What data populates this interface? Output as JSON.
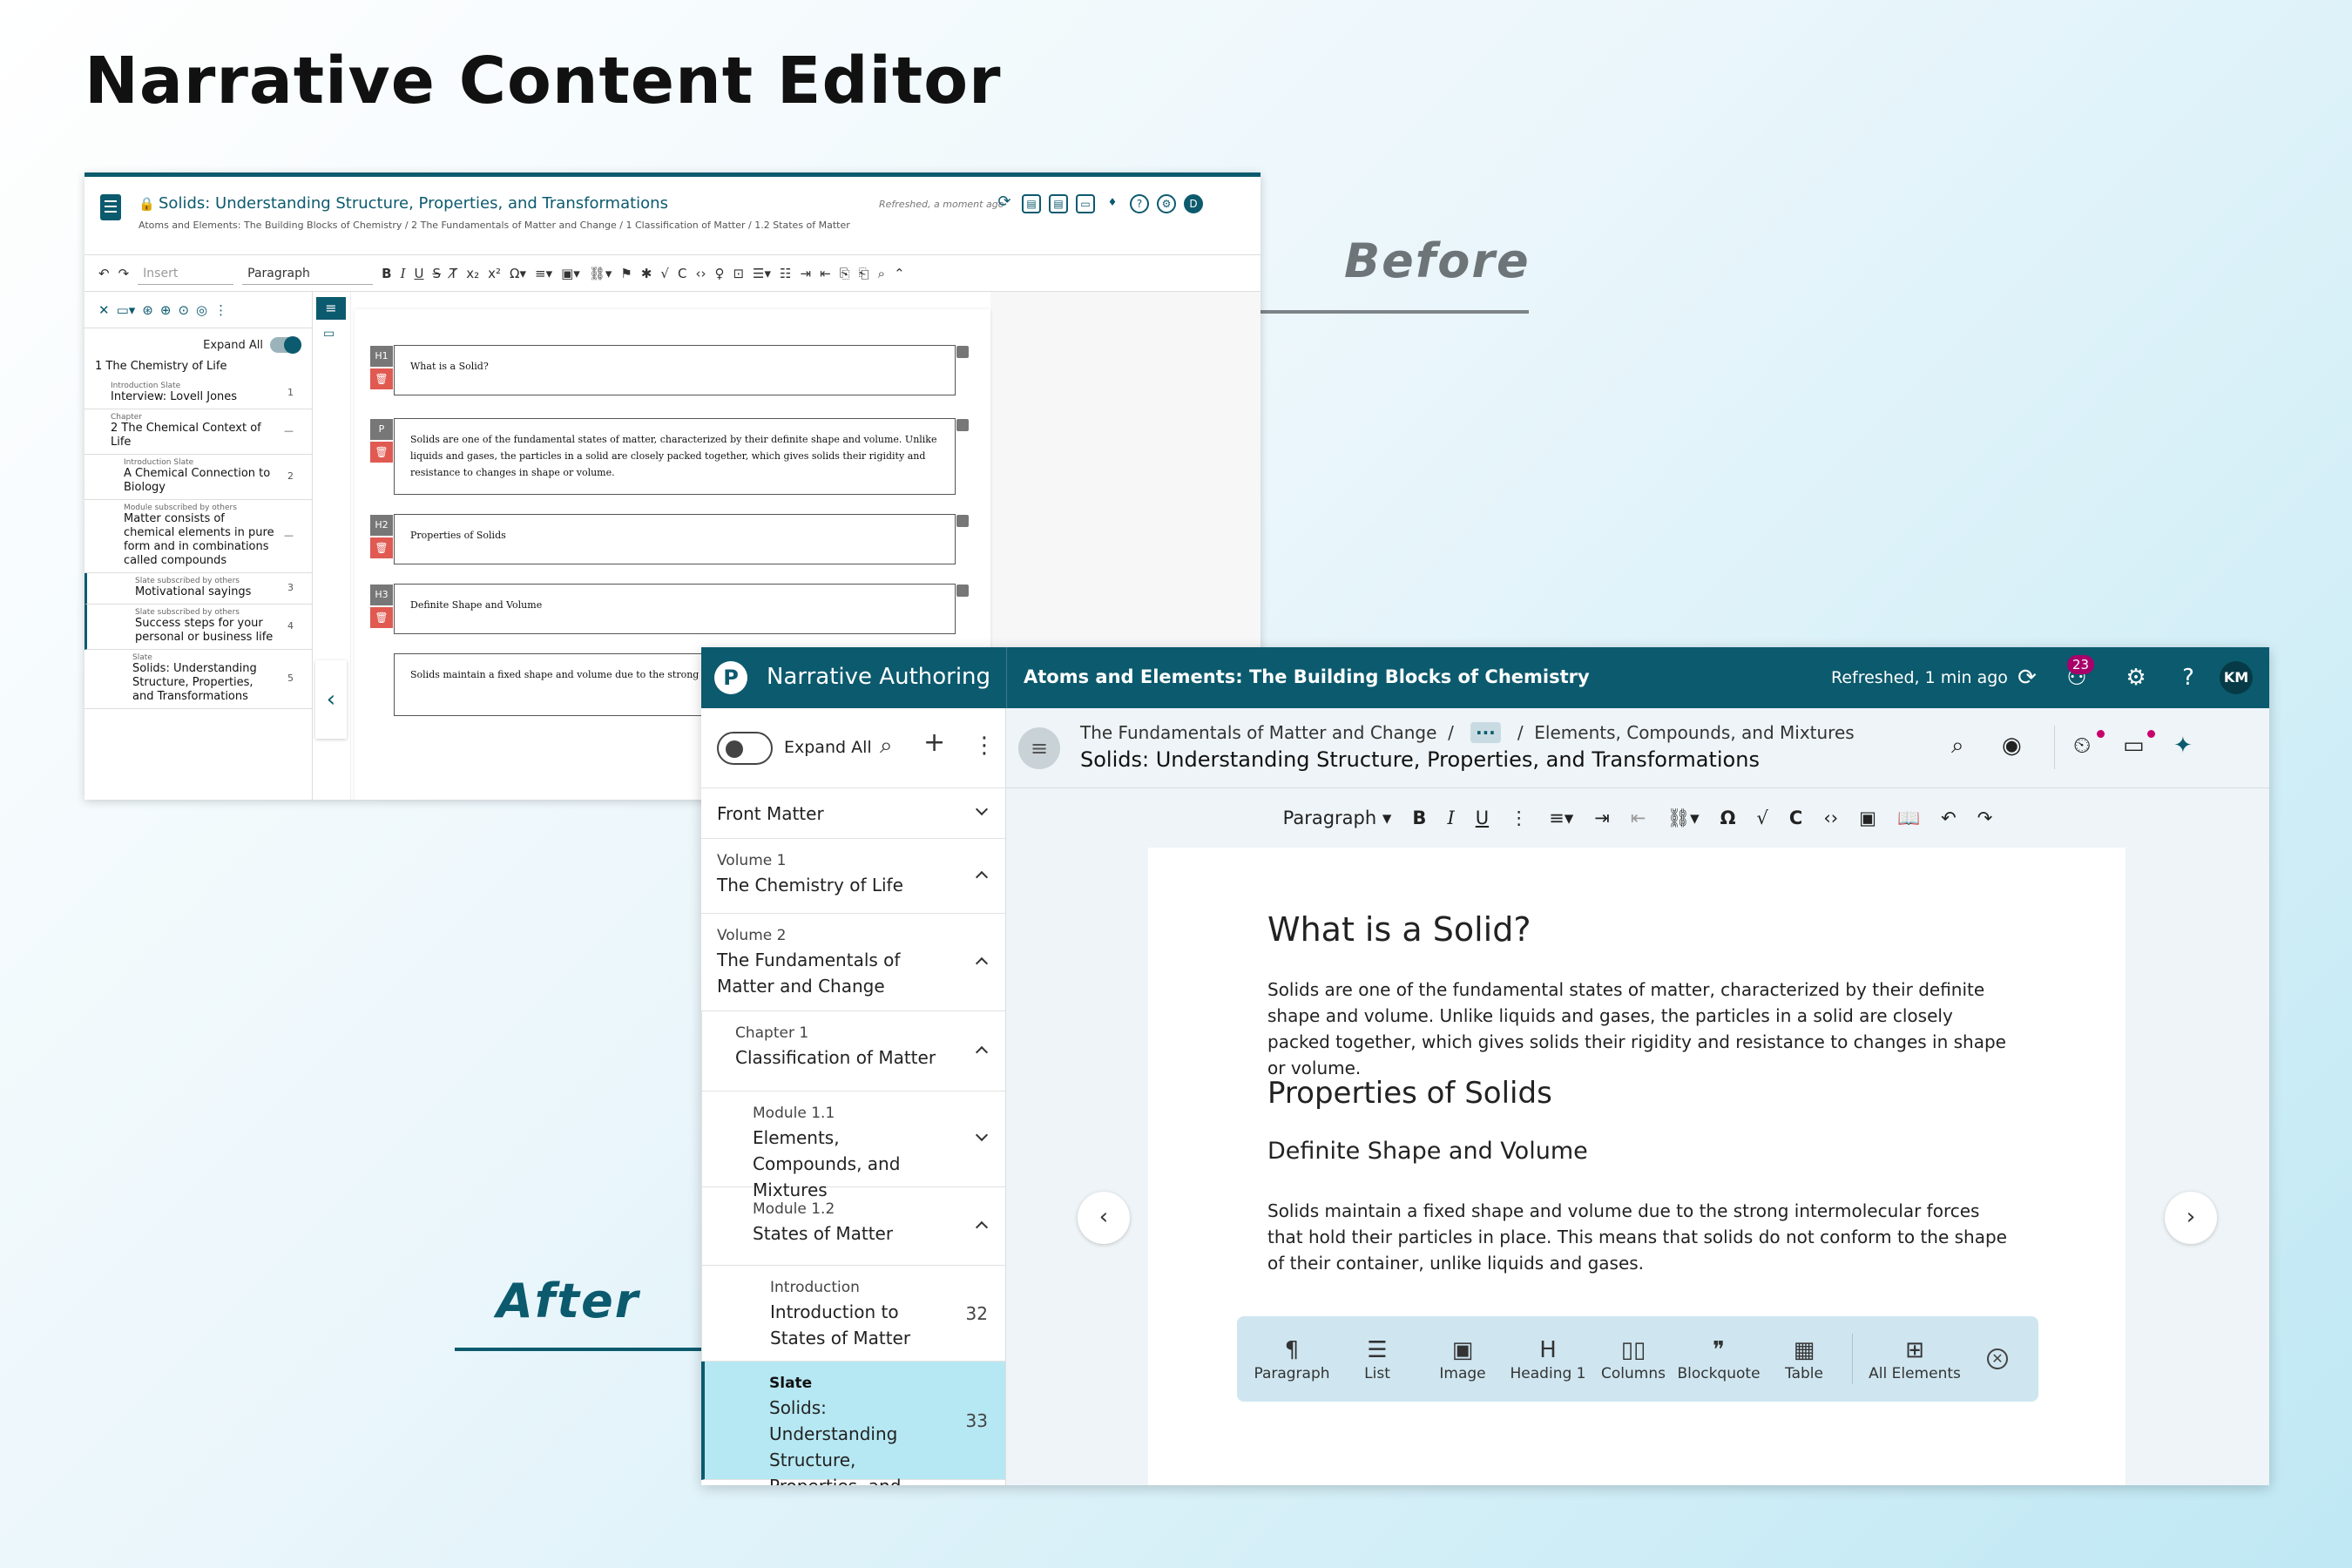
{
  "page_title": "Narrative Content Editor",
  "labels": {
    "before": "Before",
    "after": "After"
  },
  "before": {
    "title": "Solids: Understanding Structure, Properties, and Transformations",
    "breadcrumb": "Atoms and Elements: The Building Blocks of Chemistry  /  2 The Fundamentals of Matter and Change  /  1 Classification of Matter  /  1.2 States of Matter",
    "refreshed": "Refreshed, a moment ago",
    "avatar": "D",
    "insert_placeholder": "Insert",
    "paragraph_select": "Paragraph",
    "expand_all": "Expand All",
    "tree": [
      {
        "caption": "",
        "name": "1 The Chemistry of Life",
        "num": ""
      },
      {
        "caption": "Introduction Slate",
        "name": "Interview: Lovell Jones",
        "num": "1"
      },
      {
        "caption": "Chapter",
        "name": "2 The Chemical Context of Life",
        "num": "—"
      },
      {
        "caption": "Introduction Slate",
        "name": "A Chemical Connection to Biology",
        "num": "2"
      },
      {
        "caption": "Module subscribed by others",
        "name": "Matter consists of chemical elements in pure form and in combinations called compounds",
        "num": "—"
      },
      {
        "caption": "Slate subscribed by others",
        "name": "Motivational sayings",
        "num": "3"
      },
      {
        "caption": "Slate subscribed by others",
        "name": "Success steps for your personal or business life",
        "num": "4"
      },
      {
        "caption": "Slate",
        "name": "Solids: Understanding Structure, Properties, and Transformations",
        "num": "5"
      }
    ],
    "elements": [
      {
        "tag": "H1",
        "text": "What is a Solid?"
      },
      {
        "tag": "P",
        "text": "Solids are one of the fundamental states of matter, characterized by their definite shape and volume. Unlike liquids and gases, the particles in a solid are closely packed together, which gives solids their rigidity and resistance to changes in shape or volume."
      },
      {
        "tag": "H2",
        "text": "Properties of Solids"
      },
      {
        "tag": "H3",
        "text": "Definite Shape and Volume"
      },
      {
        "tag": "P",
        "text": "Solids maintain a fixed shape and volume due to the strong intermolecular forces that hold their particles in place. This means that solids do not conform to the shape of their container, unlike liquids and gases."
      }
    ]
  },
  "after": {
    "app_name": "Narrative Authoring",
    "book_title": "Atoms and Elements: The Building Blocks of Chemistry",
    "refreshed": "Refreshed, 1 min ago",
    "badge": "23",
    "avatar": "KM",
    "expand_all": "Expand All",
    "tree": [
      {
        "caption": "",
        "name": "Front Matter",
        "num": "",
        "chev": "dn",
        "indent": 0
      },
      {
        "caption": "Volume 1",
        "name": "The Chemistry of Life",
        "num": "",
        "chev": "up",
        "indent": 0
      },
      {
        "caption": "Volume 2",
        "name": "The Fundamentals of Matter and Change",
        "num": "",
        "chev": "up",
        "indent": 0
      },
      {
        "caption": "Chapter 1",
        "name": "Classification of Matter",
        "num": "",
        "chev": "up",
        "indent": 1
      },
      {
        "caption": "Module 1.1",
        "name": "Elements, Compounds, and Mixtures",
        "num": "",
        "chev": "dn",
        "indent": 2
      },
      {
        "caption": "Module 1.2",
        "name": "States of Matter",
        "num": "",
        "chev": "up",
        "indent": 2
      },
      {
        "caption": "Introduction",
        "name": "Introduction to States of Matter",
        "num": "32",
        "chev": "",
        "indent": 3
      },
      {
        "caption": "Slate",
        "name": "Solids: Understanding Structure, Properties, and Transformations",
        "num": "33",
        "chev": "",
        "indent": 3
      }
    ],
    "breadcrumb_a": "The Fundamentals of Matter and Change",
    "breadcrumb_dots": "···",
    "breadcrumb_b": "Elements, Compounds, and Mixtures",
    "header_title": "Solids: Understanding Structure, Properties, and Transformations",
    "format_select": "Paragraph",
    "content": {
      "h1": "What is a Solid?",
      "p1": "Solids are one of the fundamental states of matter, characterized by their definite shape and volume. Unlike liquids and gases, the particles in a solid are closely packed together, which gives solids their rigidity and resistance to changes in shape or volume.",
      "h2": "Properties of Solids",
      "h3": "Definite Shape and Volume",
      "p2": "Solids maintain a fixed shape and volume due to the strong intermolecular forces that hold their particles in place. This means that solids do not conform to the shape of their container, unlike liquids and gases."
    },
    "insert_bar": [
      {
        "icon": "¶",
        "label": "Paragraph"
      },
      {
        "icon": "☰",
        "label": "List"
      },
      {
        "icon": "▣",
        "label": "Image"
      },
      {
        "icon": "H",
        "label": "Heading 1"
      },
      {
        "icon": "▯▯",
        "label": "Columns"
      },
      {
        "icon": "❞",
        "label": "Blockquote"
      },
      {
        "icon": "▦",
        "label": "Table"
      }
    ],
    "all_elements": {
      "icon": "⊞",
      "label": "All Elements"
    }
  }
}
